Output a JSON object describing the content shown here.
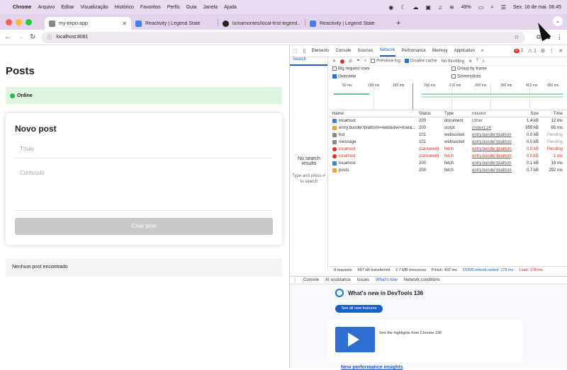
{
  "menubar": {
    "items": [
      "Chrome",
      "Arquivo",
      "Editar",
      "Visualização",
      "Histórico",
      "Favoritos",
      "Perfis",
      "Guia",
      "Janela",
      "Ajuda"
    ],
    "battery": "49%",
    "datetime": "Sex. 16 de mai.  06:45"
  },
  "tabs": [
    {
      "title": "my-expo-app",
      "fav_color": "#888888"
    },
    {
      "title": "Reactivity | Legend State",
      "fav_color": "#3b82f6"
    },
    {
      "title": "lumamontes/local-first-legend...",
      "fav_color": "#222222"
    },
    {
      "title": "Reactivity | Legend State",
      "fav_color": "#3b82f6"
    }
  ],
  "address": {
    "url": "localhost:8081"
  },
  "page": {
    "title": "Posts",
    "status": "Online",
    "form": {
      "title": "Novo post",
      "title_placeholder": "Título",
      "content_placeholder": "Conteúdo",
      "submit_label": "Criar post"
    },
    "empty_message": "Nenhum post encontrado"
  },
  "devtools": {
    "panels": [
      "Elements",
      "Console",
      "Sources",
      "Network",
      "Performance",
      "Memory",
      "Application"
    ],
    "active_panel": "Network",
    "error_count": "1",
    "warn_count": "1",
    "search_tab": "Search",
    "no_results": "No search results",
    "search_hint": "Type and press ↵ to search",
    "options": {
      "preserve_log": "Preserve log",
      "disable_cache": "Disable cache",
      "throttling": "No throttling",
      "big_rows": "Big request rows",
      "group_by_frame": "Group by frame",
      "overview": "Overview",
      "screenshots": "Screenshots"
    },
    "timeline_ticks": [
      "50 ms",
      "100 ms",
      "150 ms",
      "200 ms",
      "250 ms",
      "300 ms",
      "350 ms",
      "400 ms",
      "450 ms",
      "500 ms"
    ],
    "columns": [
      "Name",
      "Status",
      "Type",
      "Initiator",
      "Size",
      "Time"
    ],
    "rows": [
      {
        "name": "localhost",
        "status": "200",
        "type": "document",
        "initiator": "Other",
        "size": "1.4 kB",
        "time": "12 ms",
        "icon_color": "#4a7bd0",
        "error": false
      },
      {
        "name": "entry.bundle?platform=web&dev=true&...",
        "status": "200",
        "type": "script",
        "initiator": "(index):24",
        "size": "655 kB",
        "time": "65 ms",
        "icon_color": "#e8a33b",
        "error": false
      },
      {
        "name": "hot",
        "status": "101",
        "type": "websocket",
        "initiator": "entry.bundle?platfom",
        "size": "0.0 kB",
        "time": "Pending",
        "icon_color": "#888888",
        "error": false
      },
      {
        "name": "message",
        "status": "101",
        "type": "websocket",
        "initiator": "entry.bundle?platfom",
        "size": "0.0 kB",
        "time": "Pending",
        "icon_color": "#888888",
        "error": false
      },
      {
        "name": "localhost",
        "status": "(canceled)",
        "type": "fetch",
        "initiator": "entry.bundle?platfom",
        "size": "0.0 kB",
        "time": "Pending",
        "icon_color": "#d93025",
        "error": true
      },
      {
        "name": "localhost",
        "status": "(canceled)",
        "type": "fetch",
        "initiator": "entry.bundle?platfom",
        "size": "0.0 kB",
        "time": "1 ms",
        "icon_color": "#d93025",
        "error": true
      },
      {
        "name": "localhost",
        "status": "200",
        "type": "fetch",
        "initiator": "entry.bundle?platfom",
        "size": "0.1 kB",
        "time": "19 ms",
        "icon_color": "#4a7bd0",
        "error": false
      },
      {
        "name": "posts",
        "status": "200",
        "type": "fetch",
        "initiator": "entry.bundle?platfom",
        "size": "0.7 kB",
        "time": "292 ms",
        "icon_color": "#e8a33b",
        "error": false
      }
    ],
    "summary": {
      "requests": "8 requests",
      "transferred": "657 kB transferred",
      "resources": "2.7 MB resources",
      "finish": "Finish: 492 ms",
      "dcl": "DOMContentLoaded: 178 ms",
      "load": "Load: 178 ms"
    },
    "drawer_tabs": [
      "Console",
      "AI assistance",
      "Issues",
      "What's new",
      "Network conditions"
    ],
    "drawer_active": "What's new",
    "whatsnew": {
      "title": "What's new in DevTools 136",
      "button": "See all new features",
      "desc": "See the highlights from Chrome 136",
      "link": "New performance insights"
    }
  },
  "colors": {
    "online_bg": "#dff7e2",
    "accent": "#1a5fc4",
    "error": "#d93025"
  }
}
